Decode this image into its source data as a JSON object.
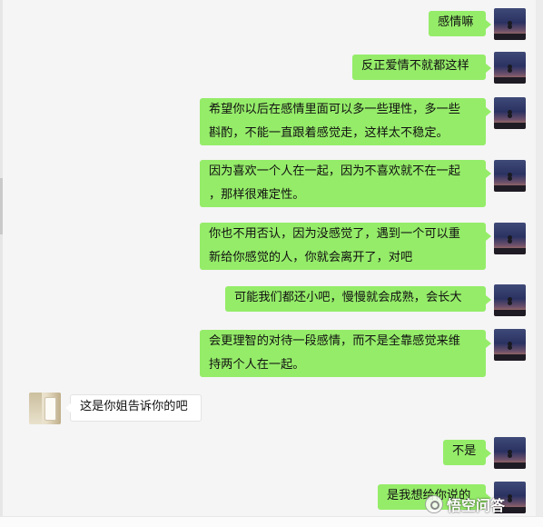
{
  "messages": [
    {
      "side": "right",
      "lines": [
        "感情嘛"
      ]
    },
    {
      "side": "right",
      "lines": [
        "反正爱情不就都这样"
      ]
    },
    {
      "side": "right",
      "lines": [
        "希望你以后在感情里面可以多一些理性，多一些",
        "斟酌，不能一直跟着感觉走，这样太不稳定。"
      ]
    },
    {
      "side": "right",
      "lines": [
        "因为喜欢一个人在一起，因为不喜欢就不在一起",
        "，那样很难定性。"
      ]
    },
    {
      "side": "right",
      "lines": [
        "你也不用否认，因为没感觉了，遇到一个可以重",
        "新给你感觉的人，你就会离开了，对吧"
      ]
    },
    {
      "side": "right",
      "lines": [
        "可能我们都还小吧，慢慢就会成熟，会长大"
      ]
    },
    {
      "side": "right",
      "lines": [
        "会更理智的对待一段感情，而不是全靠感觉来维",
        "持两个人在一起。"
      ]
    },
    {
      "side": "left",
      "lines": [
        "这是你姐告诉你的吧"
      ]
    },
    {
      "side": "right",
      "lines": [
        "不是"
      ]
    },
    {
      "side": "right",
      "lines": [
        "是我想给你说的"
      ]
    }
  ],
  "watermark": {
    "text": "悟空问答",
    "icon": "wukong-logo-icon"
  },
  "colors": {
    "sent_bubble": "#95ec69",
    "received_bubble": "#ffffff",
    "background": "#f5f5f5"
  }
}
